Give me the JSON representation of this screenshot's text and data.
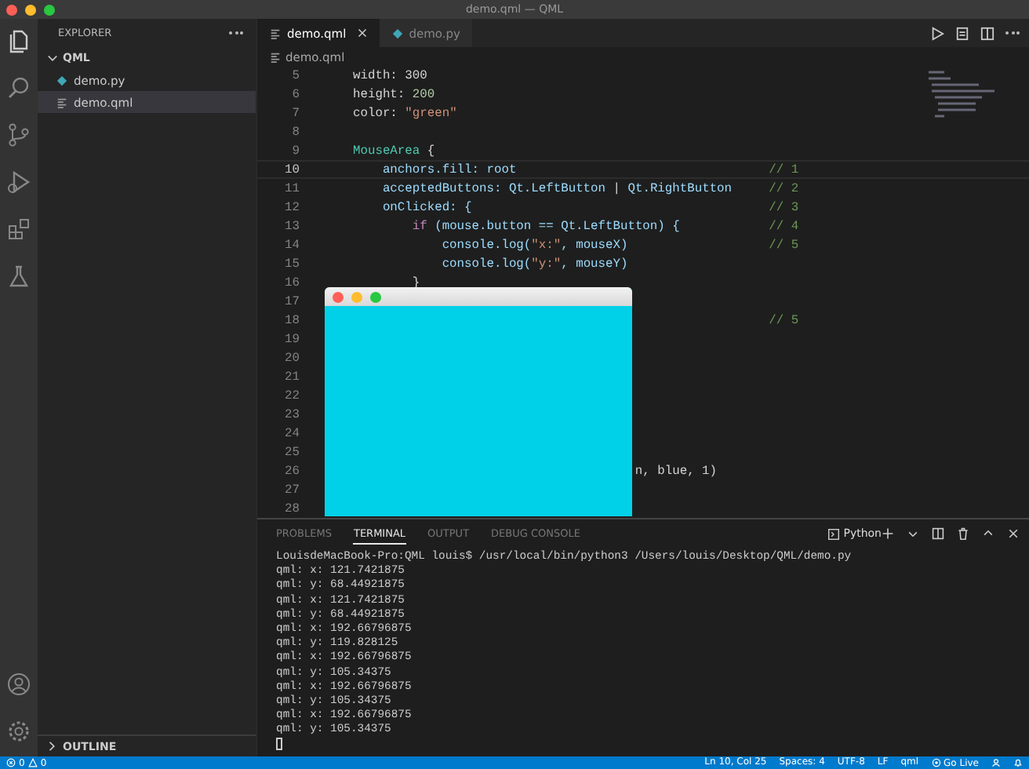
{
  "window": {
    "title": "demo.qml — QML"
  },
  "sidebar": {
    "title": "EXPLORER",
    "folder": {
      "label": "QML",
      "expanded": true,
      "children": [
        {
          "label": "demo.py",
          "kind": "py",
          "selected": false
        },
        {
          "label": "demo.qml",
          "kind": "qml",
          "selected": true
        }
      ]
    },
    "outline": {
      "label": "OUTLINE",
      "expanded": false
    }
  },
  "tabs": [
    {
      "label": "demo.qml",
      "kind": "qml",
      "selected": true
    },
    {
      "label": "demo.py",
      "kind": "py",
      "selected": false
    }
  ],
  "breadcrumb": {
    "label": "demo.qml"
  },
  "code": {
    "lines": [
      {
        "num": "5",
        "tokens": [
          {
            "text": "width: 300",
            "kind": "plain"
          }
        ]
      },
      {
        "num": "6",
        "tokens": [
          {
            "text": "height: ",
            "kind": "plain"
          },
          {
            "text": "200",
            "kind": "number"
          }
        ]
      },
      {
        "num": "7",
        "tokens": [
          {
            "text": "color: ",
            "kind": "plain"
          },
          {
            "text": "\"green\"",
            "kind": "string"
          }
        ]
      },
      {
        "num": "8"
      },
      {
        "num": "9",
        "tokens": [
          {
            "text": "MouseArea",
            "kind": "type"
          },
          {
            "text": " {",
            "kind": "plain"
          }
        ]
      },
      {
        "num": "10",
        "current": true,
        "tokens": [
          {
            "text": "    anchors.fill: ",
            "kind": "prop"
          },
          {
            "text": "root",
            "kind": "prop"
          }
        ],
        "comment": "// 1"
      },
      {
        "num": "11",
        "tokens": [
          {
            "text": "    acceptedButtons: ",
            "kind": "prop"
          },
          {
            "text": "Qt.LeftButton",
            "kind": "prop"
          },
          {
            "text": " | ",
            "kind": "plain"
          },
          {
            "text": "Qt.RightButton",
            "kind": "prop"
          }
        ],
        "comment": "// 2"
      },
      {
        "num": "12",
        "tokens": [
          {
            "text": "    onClicked: {",
            "kind": "prop"
          }
        ],
        "comment": "// 3"
      },
      {
        "num": "13",
        "tokens": [
          {
            "text": "        if",
            "kind": "keyword"
          },
          {
            "text": " (mouse.button == Qt.LeftButton) {",
            "kind": "prop"
          }
        ],
        "comment": "// 4"
      },
      {
        "num": "14",
        "tokens": [
          {
            "text": "            console.log(",
            "kind": "prop"
          },
          {
            "text": "\"x:\"",
            "kind": "string"
          },
          {
            "text": ", mouseX)",
            "kind": "prop"
          }
        ],
        "comment": "// 5"
      },
      {
        "num": "15",
        "tokens": [
          {
            "text": "            console.log(",
            "kind": "prop"
          },
          {
            "text": "\"y:\"",
            "kind": "string"
          },
          {
            "text": ", mouseY)",
            "kind": "prop"
          }
        ]
      },
      {
        "num": "16",
        "tokens": [
          {
            "text": "        }",
            "kind": "plain"
          }
        ]
      },
      {
        "num": "17"
      },
      {
        "num": "18",
        "comment": "// 5"
      },
      {
        "num": "19"
      },
      {
        "num": "20"
      },
      {
        "num": "21"
      },
      {
        "num": "22"
      },
      {
        "num": "23"
      },
      {
        "num": "24"
      },
      {
        "num": "25"
      },
      {
        "num": "26",
        "tokens": [
          {
            "text": "                                      n, blue, 1)",
            "kind": "plain"
          }
        ]
      },
      {
        "num": "27"
      },
      {
        "num": "28"
      }
    ]
  },
  "panel": {
    "tabs": [
      {
        "label": "PROBLEMS",
        "selected": false
      },
      {
        "label": "TERMINAL",
        "selected": true
      },
      {
        "label": "OUTPUT",
        "selected": false
      },
      {
        "label": "DEBUG CONSOLE",
        "selected": false
      }
    ],
    "terminal_name": "Python",
    "lines": [
      "LouisdeMacBook-Pro:QML louis$ /usr/local/bin/python3 /Users/louis/Desktop/QML/demo.py",
      "qml: x: 121.7421875",
      "qml: y: 68.44921875",
      "qml: x: 121.7421875",
      "qml: y: 68.44921875",
      "qml: x: 192.66796875",
      "qml: y: 119.828125",
      "qml: x: 192.66796875",
      "qml: y: 105.34375",
      "qml: x: 192.66796875",
      "qml: y: 105.34375",
      "qml: x: 192.66796875",
      "qml: y: 105.34375"
    ]
  },
  "status_bar": {
    "errors": "0",
    "warnings": "0",
    "items": [
      "Ln 10, Col 25",
      "Spaces: 4",
      "UTF-8",
      "LF",
      "qml"
    ],
    "live": "Go Live"
  }
}
